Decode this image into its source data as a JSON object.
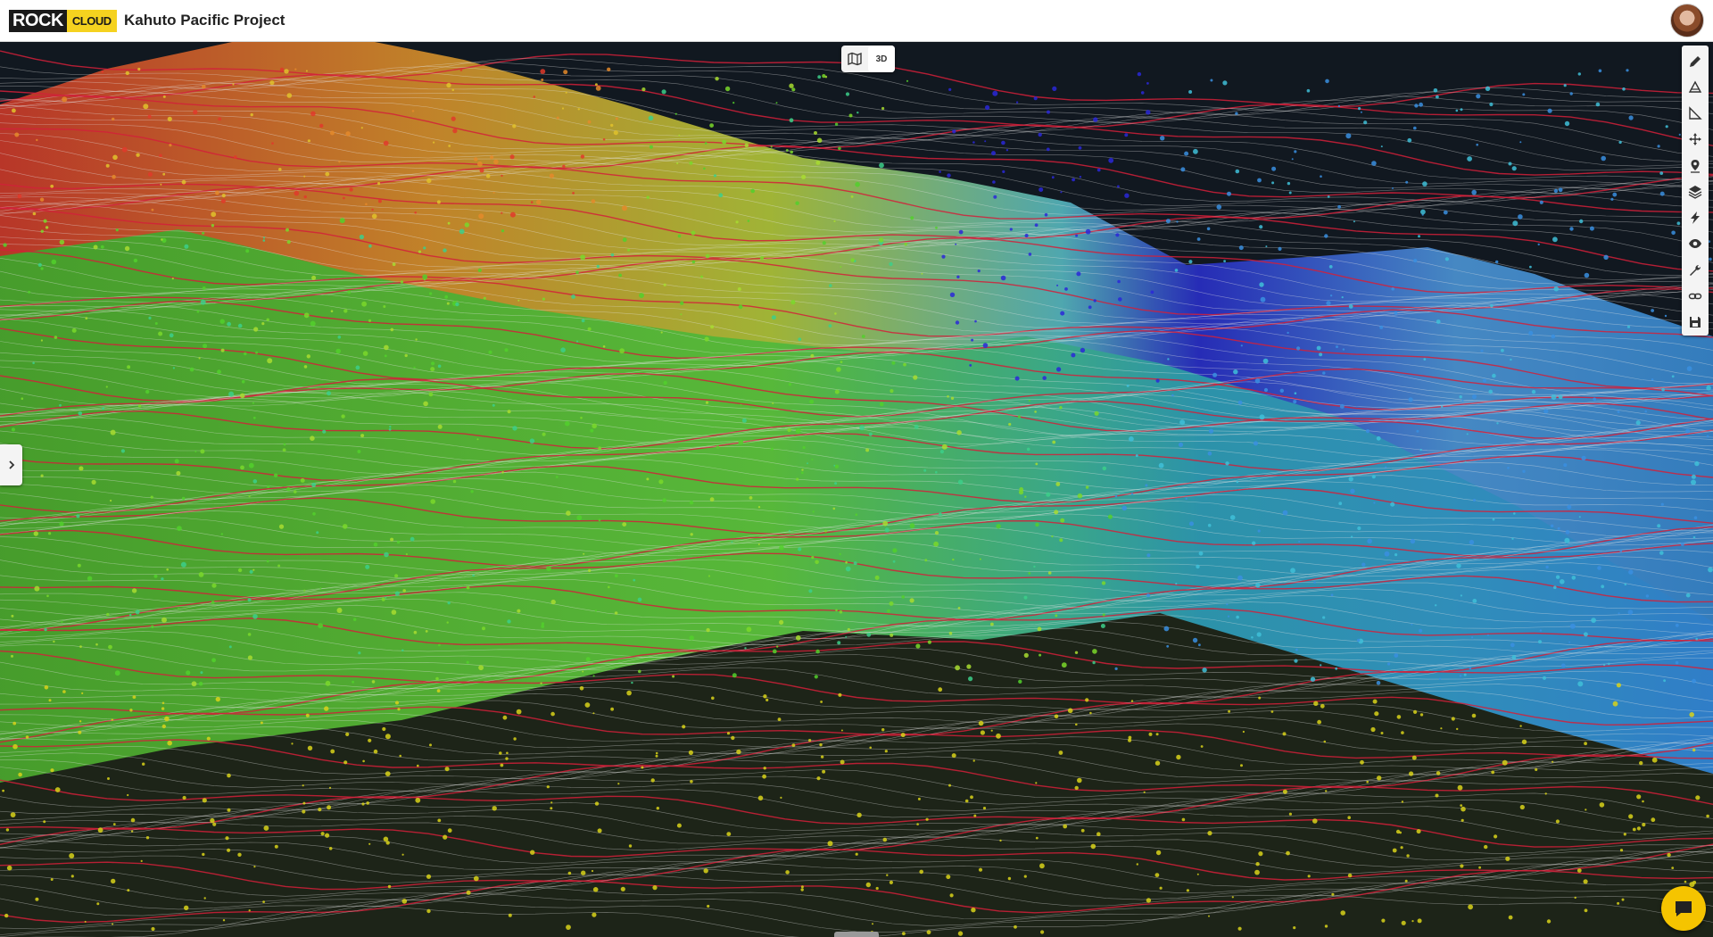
{
  "app": {
    "logo_rock": "ROCK",
    "logo_cloud": "CLOUD",
    "project_title": "Kahuto Pacific Project"
  },
  "view_toggle": {
    "map_icon": "map-icon",
    "mode_3d_label": "3D",
    "active": "3D"
  },
  "toolbar": {
    "tools": [
      {
        "icon": "pencil-icon"
      },
      {
        "icon": "volume-icon"
      },
      {
        "icon": "angle-measure-icon"
      },
      {
        "icon": "move-icon"
      },
      {
        "icon": "location-pin-icon"
      },
      {
        "icon": "layers-icon"
      },
      {
        "icon": "lightning-icon"
      },
      {
        "icon": "eye-icon"
      },
      {
        "icon": "wrench-icon"
      },
      {
        "icon": "link-icon"
      },
      {
        "icon": "save-icon"
      }
    ]
  },
  "colors": {
    "header_bg": "#ffffff",
    "viewport_bg": "#111820",
    "logo_yellow": "#f5d21f",
    "chat_yellow": "#f5c400",
    "contour_red": "#d2203a",
    "contour_white": "#e6e6e6"
  },
  "side_panel": {
    "icon": "chevron-right-icon"
  },
  "chat": {
    "icon": "chat-icon"
  }
}
